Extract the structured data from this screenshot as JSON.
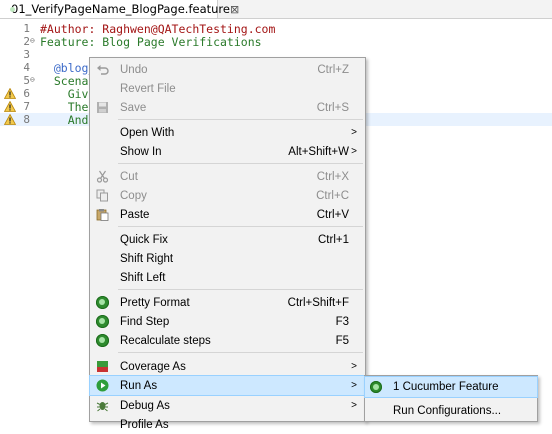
{
  "tab": {
    "title": "01_VerifyPageName_BlogPage.feature",
    "close": "⊠"
  },
  "editor": {
    "lines": [
      {
        "num": "1",
        "text": "#Author: Raghwen@QATechTesting.com"
      },
      {
        "num": "2",
        "text": "Feature: Blog Page Verifications"
      },
      {
        "num": "3",
        "text": ""
      },
      {
        "num": "4",
        "text": "  @blog_"
      },
      {
        "num": "5",
        "text": "  Scenar"
      },
      {
        "num": "6",
        "text": "    Give"
      },
      {
        "num": "7",
        "text": "    Then"
      },
      {
        "num": "8",
        "text": "    And "
      }
    ]
  },
  "context_menu": {
    "undo": {
      "label": "Undo",
      "shortcut": "Ctrl+Z"
    },
    "revert": {
      "label": "Revert File"
    },
    "save": {
      "label": "Save",
      "shortcut": "Ctrl+S"
    },
    "open_with": {
      "label": "Open With"
    },
    "show_in": {
      "label": "Show In",
      "shortcut": "Alt+Shift+W"
    },
    "cut": {
      "label": "Cut",
      "shortcut": "Ctrl+X"
    },
    "copy": {
      "label": "Copy",
      "shortcut": "Ctrl+C"
    },
    "paste": {
      "label": "Paste",
      "shortcut": "Ctrl+V"
    },
    "quick_fix": {
      "label": "Quick Fix",
      "shortcut": "Ctrl+1"
    },
    "shift_right": {
      "label": "Shift Right"
    },
    "shift_left": {
      "label": "Shift Left"
    },
    "pretty_format": {
      "label": "Pretty Format",
      "shortcut": "Ctrl+Shift+F"
    },
    "find_step": {
      "label": "Find Step",
      "shortcut": "F3"
    },
    "recalculate": {
      "label": "Recalculate steps",
      "shortcut": "F5"
    },
    "coverage_as": {
      "label": "Coverage As"
    },
    "run_as": {
      "label": "Run As"
    },
    "debug_as": {
      "label": "Debug As"
    },
    "profile_as": {
      "label": "Profile As"
    }
  },
  "run_as_submenu": {
    "cucumber": {
      "label": "1 Cucumber Feature"
    },
    "run_configs": {
      "label": "Run Configurations..."
    }
  },
  "colors": {
    "highlight": "#cde8ff",
    "menu_bg": "#f2f2f2",
    "cucumber_green": "#2e8b2e"
  }
}
